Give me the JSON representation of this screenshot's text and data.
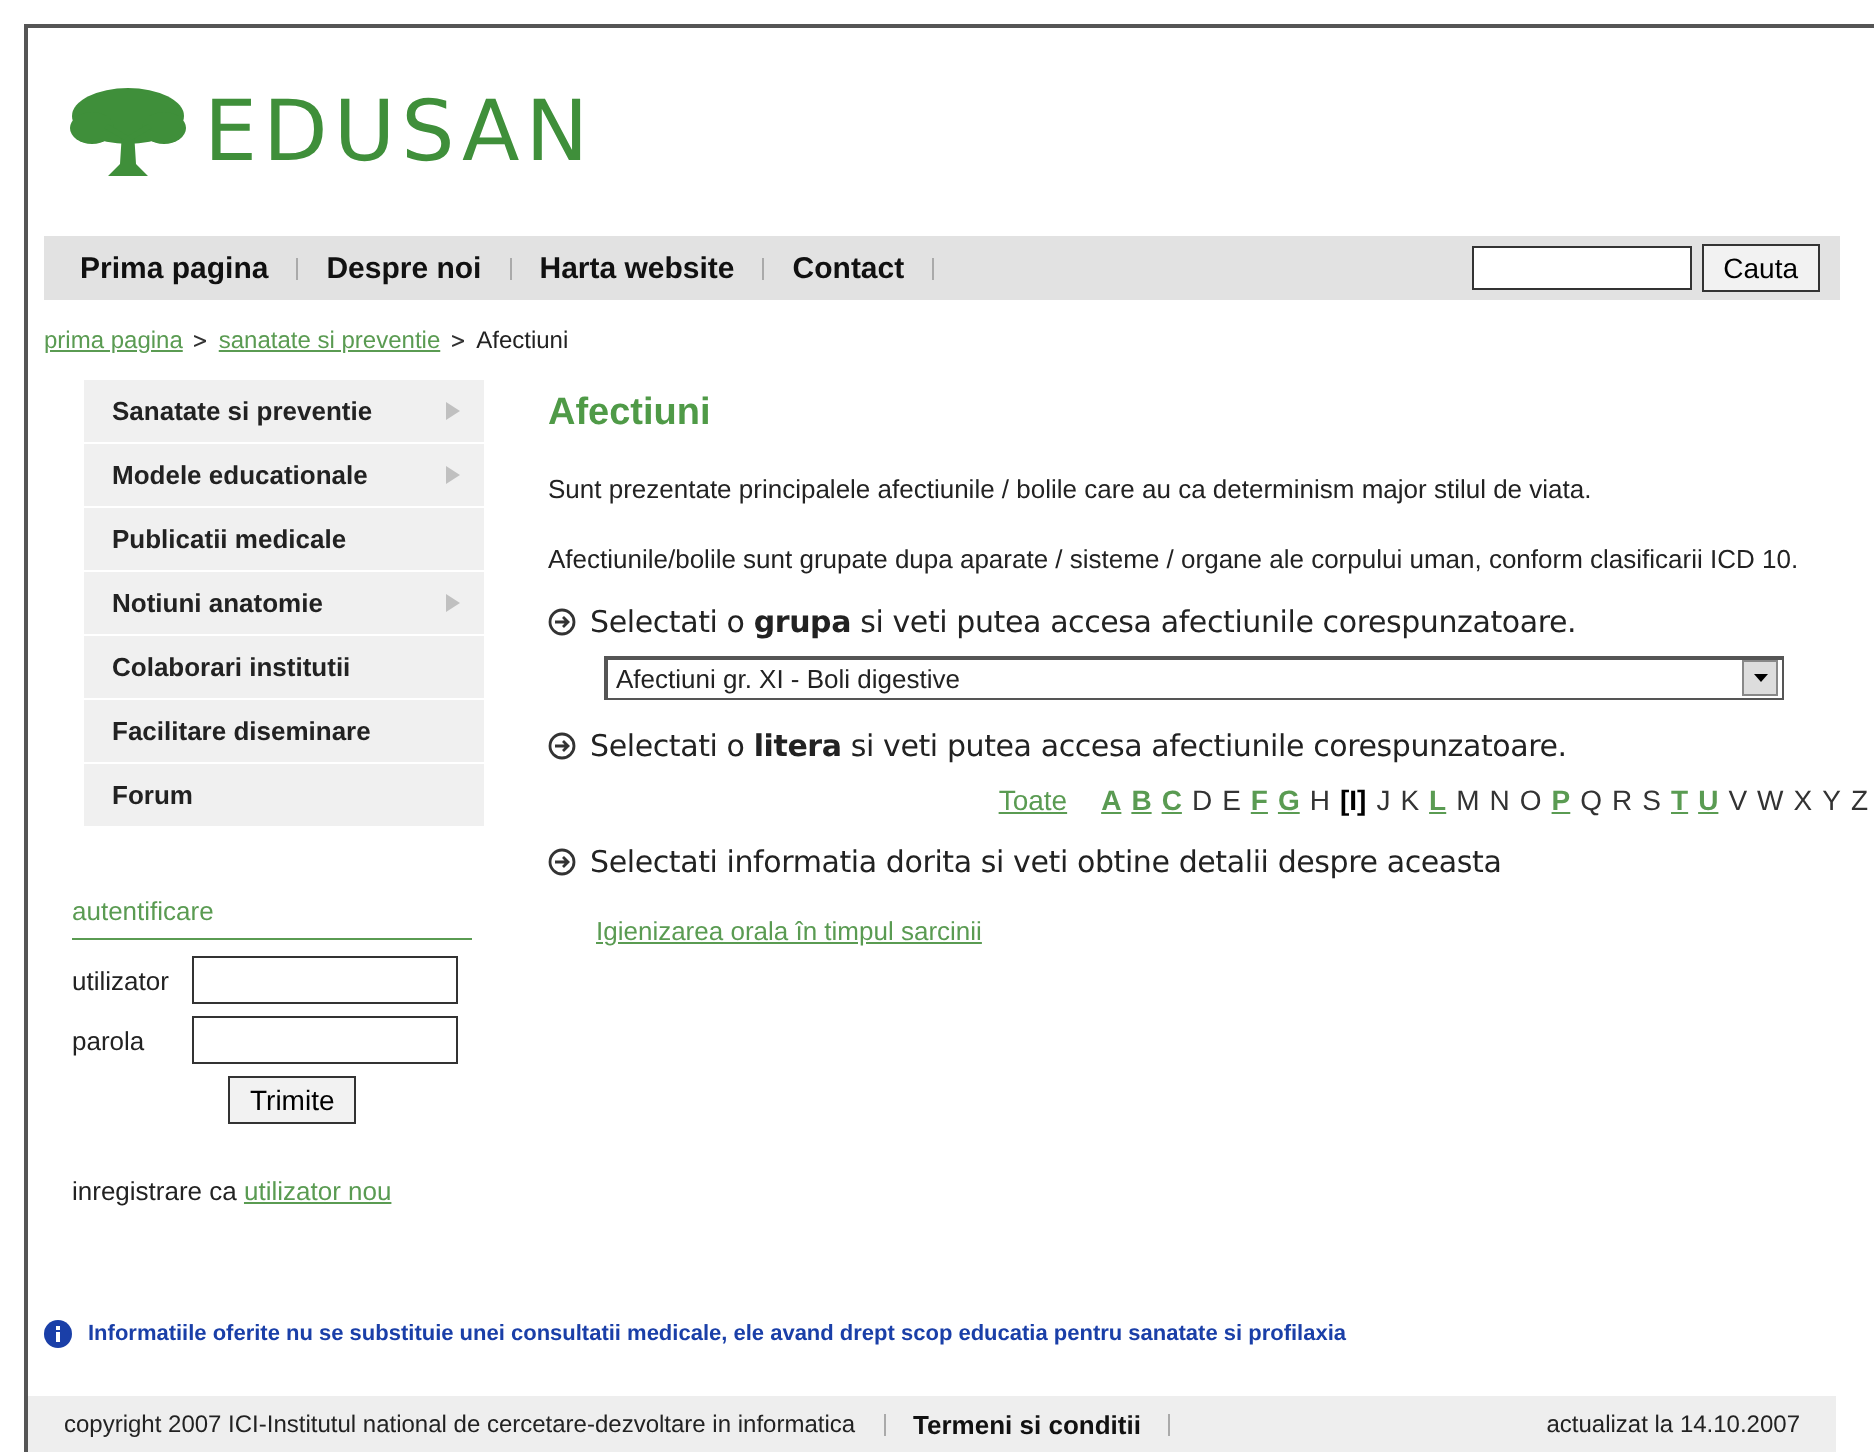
{
  "logo": {
    "text": "EDUSAN"
  },
  "nav": {
    "items": [
      "Prima pagina",
      "Despre noi",
      "Harta website",
      "Contact"
    ],
    "search_button": "Cauta"
  },
  "breadcrumb": {
    "links": [
      "prima pagina",
      "sanatate si preventie"
    ],
    "current": "Afectiuni"
  },
  "sidebar": {
    "items": [
      {
        "label": "Sanatate si preventie",
        "expandable": true
      },
      {
        "label": "Modele educationale",
        "expandable": true
      },
      {
        "label": "Publicatii medicale",
        "expandable": false
      },
      {
        "label": "Notiuni anatomie",
        "expandable": true
      },
      {
        "label": "Colaborari institutii",
        "expandable": false
      },
      {
        "label": "Facilitare diseminare",
        "expandable": false
      },
      {
        "label": "Forum",
        "expandable": false
      }
    ],
    "login": {
      "title": "autentificare",
      "user_label": "utilizator",
      "password_label": "parola",
      "submit": "Trimite",
      "register_text": "inregistrare ca",
      "register_link": "utilizator nou"
    }
  },
  "content": {
    "title": "Afectiuni",
    "paragraphs": [
      "Sunt prezentate principalele afectiunile / bolile care au ca determinism major stilul de viata.",
      "Afectiunile/bolile sunt grupate dupa aparate / sisteme / organe ale corpului uman, conform clasificarii ICD 10."
    ],
    "step_group": "Selectati o **grupa** si veti putea accesa afectiunile corespunzatoare.",
    "group_select": {
      "value": "Afectiuni gr. XI - Boli digestive"
    },
    "step_letter": "Selectati o **litera** si veti putea accesa afectiunile corespunzatoare.",
    "all_letters": "Toate",
    "letters": [
      {
        "text": "A",
        "kind": "link"
      },
      {
        "text": "B",
        "kind": "link"
      },
      {
        "text": "C",
        "kind": "link"
      },
      {
        "text": "D",
        "kind": "plain"
      },
      {
        "text": "E",
        "kind": "plain"
      },
      {
        "text": "F",
        "kind": "link"
      },
      {
        "text": "G",
        "kind": "link"
      },
      {
        "text": "H",
        "kind": "plain"
      },
      {
        "text": "[I]",
        "kind": "current"
      },
      {
        "text": "J",
        "kind": "plain"
      },
      {
        "text": "K",
        "kind": "plain"
      },
      {
        "text": "L",
        "kind": "link"
      },
      {
        "text": "M",
        "kind": "plain"
      },
      {
        "text": "N",
        "kind": "plain"
      },
      {
        "text": "O",
        "kind": "plain"
      },
      {
        "text": "P",
        "kind": "link"
      },
      {
        "text": "Q",
        "kind": "plain"
      },
      {
        "text": "R",
        "kind": "plain"
      },
      {
        "text": "S",
        "kind": "plain"
      },
      {
        "text": "T",
        "kind": "link"
      },
      {
        "text": "U",
        "kind": "link"
      },
      {
        "text": "V",
        "kind": "plain"
      },
      {
        "text": "W",
        "kind": "plain"
      },
      {
        "text": "X",
        "kind": "plain"
      },
      {
        "text": "Y",
        "kind": "plain"
      },
      {
        "text": "Z",
        "kind": "plain"
      }
    ],
    "step_info": "Selectati informatia dorita si veti obtine detalii despre aceasta",
    "results": [
      "Igienizarea orala în timpul sarcinii"
    ]
  },
  "notice": "Informatiile oferite nu se substituie unei consultatii medicale, ele avand drept scop educatia pentru sanatate si profilaxia",
  "footer": {
    "copyright": "copyright 2007 ICI-Institutul national de cercetare-dezvoltare in informatica",
    "terms": "Termeni si conditii",
    "updated": "actualizat la 14.10.2007"
  }
}
